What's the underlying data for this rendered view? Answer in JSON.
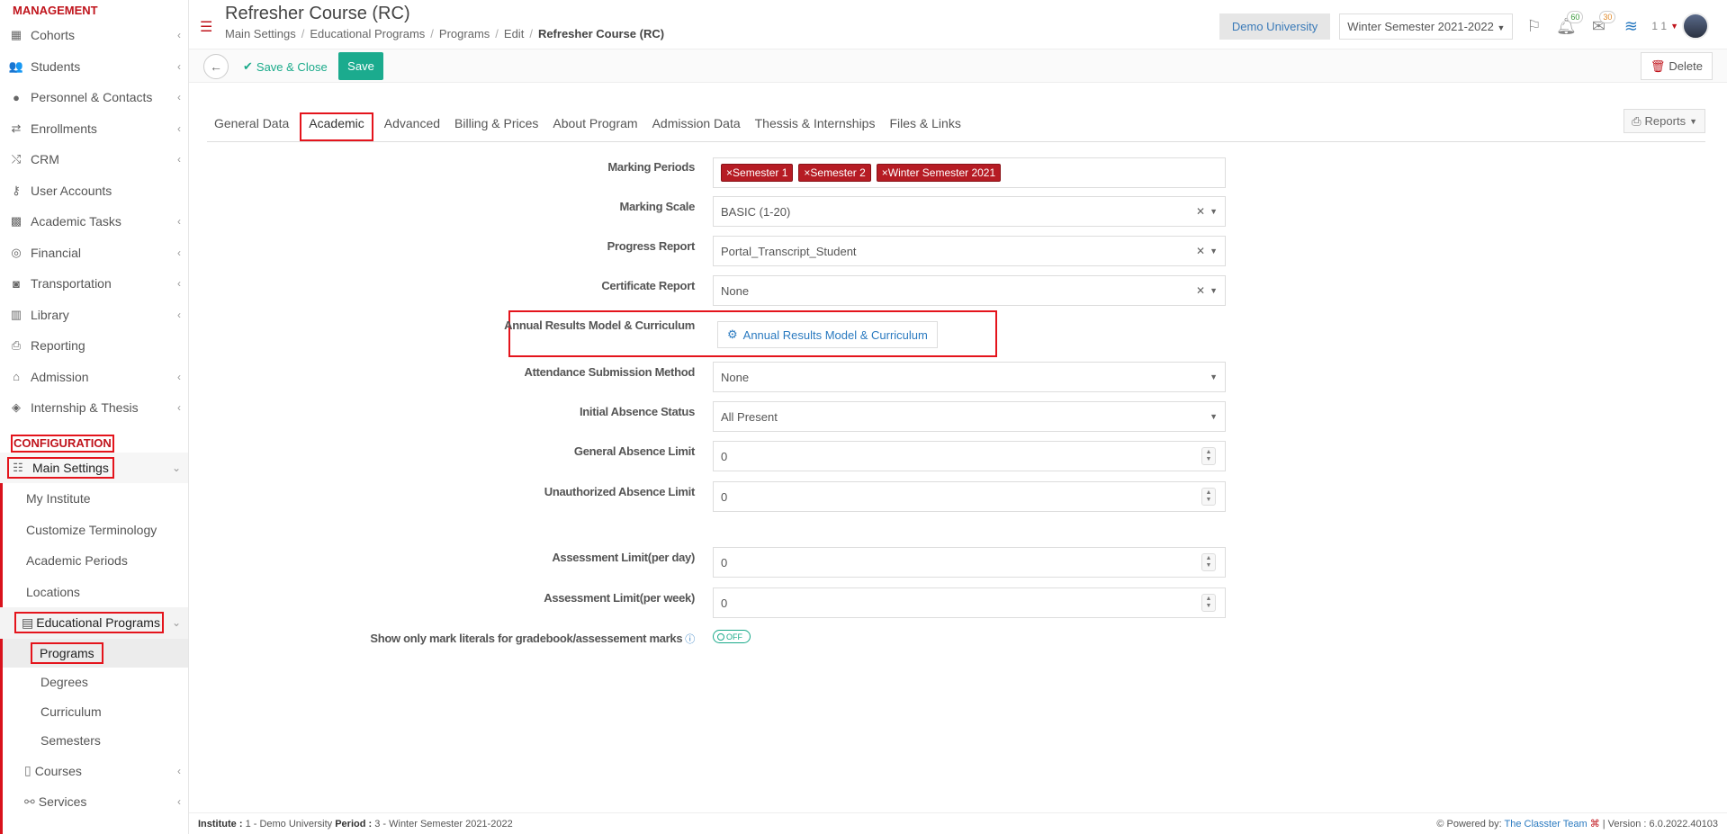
{
  "sidebar": {
    "management_title": "MANAGEMENT",
    "config_title": "CONFIGURATION",
    "items": [
      {
        "label": "Cohorts",
        "icon": "cohorts-icon"
      },
      {
        "label": "Students",
        "icon": "students-icon"
      },
      {
        "label": "Personnel & Contacts",
        "icon": "person-icon"
      },
      {
        "label": "Enrollments",
        "icon": "arrows-icon"
      },
      {
        "label": "CRM",
        "icon": "crm-icon"
      },
      {
        "label": "User Accounts",
        "icon": "key-icon"
      },
      {
        "label": "Academic Tasks",
        "icon": "grid-icon"
      },
      {
        "label": "Financial",
        "icon": "coins-icon"
      },
      {
        "label": "Transportation",
        "icon": "bus-icon"
      },
      {
        "label": "Library",
        "icon": "books-icon"
      },
      {
        "label": "Reporting",
        "icon": "printer-icon"
      },
      {
        "label": "Admission",
        "icon": "bank-icon"
      },
      {
        "label": "Internship & Thesis",
        "icon": "box-icon"
      }
    ],
    "main_settings": "Main Settings",
    "main_sub": [
      "My Institute",
      "Customize Terminology",
      "Academic Periods",
      "Locations"
    ],
    "educational_programs": "Educational Programs",
    "edu_sub": [
      "Programs",
      "Degrees",
      "Curriculum",
      "Semesters"
    ],
    "courses": "Courses",
    "services": "Services"
  },
  "header": {
    "title": "Refresher Course (RC)",
    "breadcrumb": [
      "Main Settings",
      "Educational Programs",
      "Programs",
      "Edit",
      "Refresher Course (RC)"
    ],
    "university": "Demo University",
    "semester": "Winter Semester 2021-2022",
    "notif_count": "60",
    "mail_count": "30",
    "user_short": "1 1"
  },
  "toolbar": {
    "save_close": "Save & Close",
    "save": "Save",
    "delete": "Delete"
  },
  "tabs": [
    "General Data",
    "Academic",
    "Advanced",
    "Billing & Prices",
    "About Program",
    "Admission Data",
    "Thessis & Internships",
    "Files & Links"
  ],
  "reports": "Reports",
  "form": {
    "marking_periods_label": "Marking Periods",
    "marking_periods": [
      "Semester 1",
      "Semester 2",
      "Winter Semester 2021"
    ],
    "marking_scale_label": "Marking Scale",
    "marking_scale": "BASIC (1-20)",
    "progress_report_label": "Progress Report",
    "progress_report": "Portal_Transcript_Student",
    "certificate_report_label": "Certificate Report",
    "certificate_report": "None",
    "arm_label": "Annual Results Model & Curriculum",
    "arm_button": "Annual Results Model & Curriculum",
    "attendance_label": "Attendance Submission Method",
    "attendance": "None",
    "initial_absence_label": "Initial Absence Status",
    "initial_absence": "All Present",
    "general_absence_label": "General Absence Limit",
    "general_absence": "0",
    "unauth_absence_label": "Unauthorized Absence Limit",
    "unauth_absence": "0",
    "assess_day_label": "Assessment Limit(per day)",
    "assess_day": "0",
    "assess_week_label": "Assessment Limit(per week)",
    "assess_week": "0",
    "literals_label": "Show only mark literals for gradebook/assessement marks",
    "literals_toggle": "OFF"
  },
  "footer": {
    "institute_label": "Institute :",
    "institute": "1 - Demo University",
    "period_label": "Period :",
    "period": "3 - Winter Semester 2021-2022",
    "powered": "Powered by:",
    "team": "The Classter Team",
    "version": "| Version : 6.0.2022.40103"
  },
  "colors": {
    "brand_red": "#c0141c",
    "save_green": "#1bab8e",
    "link_blue": "#2a7ac0"
  }
}
